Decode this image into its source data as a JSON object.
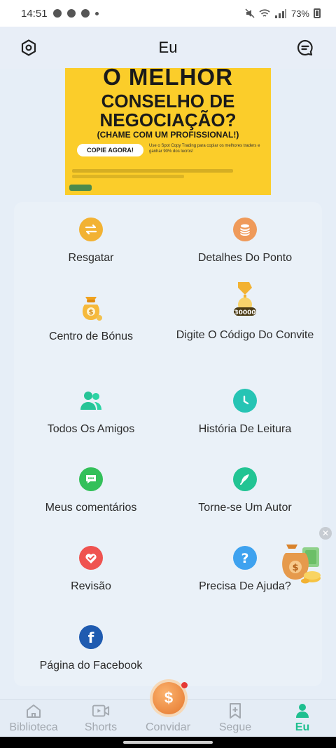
{
  "status_bar": {
    "time": "14:51",
    "battery": "73%"
  },
  "header": {
    "title": "Eu"
  },
  "banner": {
    "line1": "O MELHOR",
    "line2": "CONSELHO DE",
    "line3": "NEGOCIAÇÃO?",
    "line4": "(CHAME COM UM PROFISSIONAL!)",
    "button": "COPIE AGORA!",
    "small_text": "Use o Spot Copy Trading para copiar os melhores traders e ganhar 90% dos lucros!"
  },
  "menu": [
    {
      "label": "Resgatar",
      "icon": "swap-icon",
      "color": "#f2b233"
    },
    {
      "label": "Detalhes Do Ponto",
      "icon": "coins-stack-icon",
      "color": "#ef9a5a"
    },
    {
      "label": "Centro de Bónus",
      "icon": "money-bag-icon",
      "color": "#f2b233"
    },
    {
      "label": "Digite O Código Do Convite",
      "icon": "invite-code-icon",
      "color": "#f2b233",
      "badge": "30000"
    },
    {
      "label": "Todos Os Amigos",
      "icon": "friends-icon",
      "color": "#26c497"
    },
    {
      "label": "História De Leitura",
      "icon": "clock-icon",
      "color": "#26c4b4"
    },
    {
      "label": "Meus comentários",
      "icon": "comment-icon",
      "color": "#33c05a"
    },
    {
      "label": "Torne-se Um Autor",
      "icon": "quill-icon",
      "color": "#22c493"
    },
    {
      "label": "Revisão",
      "icon": "review-heart-icon",
      "color": "#ef5350"
    },
    {
      "label": "Precisa De Ajuda?",
      "icon": "help-icon",
      "color": "#3ea2ef"
    },
    {
      "label": "Página do Facebook",
      "icon": "facebook-icon",
      "color": "#1f5bb0"
    }
  ],
  "bottom_nav": [
    {
      "label": "Biblioteca",
      "icon": "home-icon"
    },
    {
      "label": "Shorts",
      "icon": "video-icon"
    },
    {
      "label": "Convidar",
      "icon": "coin-icon"
    },
    {
      "label": "Segue",
      "icon": "bookmark-plus-icon"
    },
    {
      "label": "Eu",
      "icon": "person-icon",
      "active": true
    }
  ]
}
